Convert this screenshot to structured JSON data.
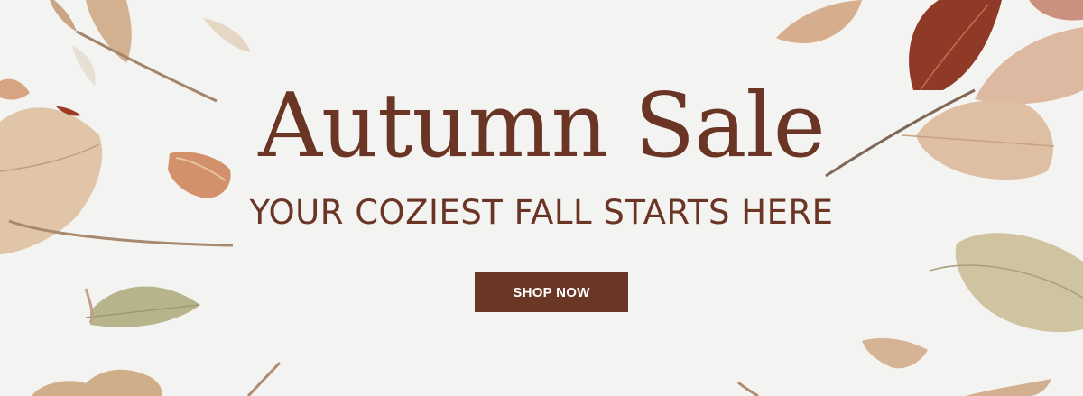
{
  "banner": {
    "headline": "Autumn Sale",
    "subheadline": "YOUR COZIEST FALL STARTS HERE",
    "cta_label": "SHOP NOW"
  },
  "colors": {
    "background": "#f3f3f1",
    "text_brown": "#6b3526",
    "button_brown": "#6a3724",
    "button_text": "#ffffff"
  },
  "decorations": [
    "dried-leaf-icon",
    "stem-icon"
  ]
}
